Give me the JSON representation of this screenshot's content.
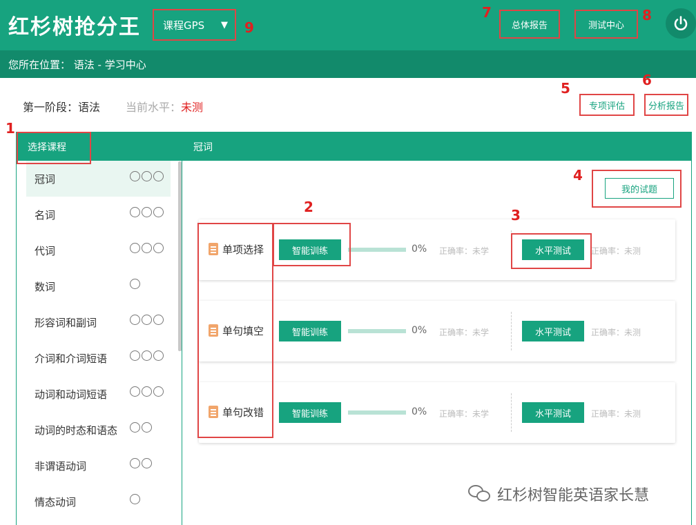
{
  "header": {
    "logo": "红杉树抢分王",
    "course_select": {
      "value": "课程GPS",
      "caret": "▼"
    },
    "overall_report": "总体报告",
    "test_center": "测试中心",
    "power_icon": "power-icon"
  },
  "breadcrumb": "您所在位置： 语法 - 学习中心",
  "stage": {
    "title": "第一阶段：语法",
    "level_label": "当前水平：",
    "level_value": "未测",
    "special_eval": "专项评估",
    "analysis_report": "分析报告"
  },
  "sidebar": {
    "title": "选择课程",
    "items": [
      {
        "label": "冠词",
        "circles": 3,
        "active": true
      },
      {
        "label": "名词",
        "circles": 3
      },
      {
        "label": "代词",
        "circles": 3
      },
      {
        "label": "数词",
        "circles": 1
      },
      {
        "label": "形容词和副词",
        "circles": 3
      },
      {
        "label": "介词和介词短语",
        "circles": 3
      },
      {
        "label": "动词和动词短语",
        "circles": 3
      },
      {
        "label": "动词的时态和语态",
        "circles": 2
      },
      {
        "label": "非谓语动词",
        "circles": 2
      },
      {
        "label": "情态动词",
        "circles": 1
      }
    ]
  },
  "main": {
    "title": "冠词",
    "my_test": "我的试题",
    "exercises": [
      {
        "title": "单项选择",
        "train": "智能训练",
        "progress": 0,
        "progress_text": "0%",
        "train_accuracy": "正确率：未学",
        "level_test": "水平测试",
        "level_accuracy": "正确率：未测"
      },
      {
        "title": "单句填空",
        "train": "智能训练",
        "progress": 0,
        "progress_text": "0%",
        "train_accuracy": "正确率：未学",
        "level_test": "水平测试",
        "level_accuracy": "正确率：未测"
      },
      {
        "title": "单句改错",
        "train": "智能训练",
        "progress": 0,
        "progress_text": "0%",
        "train_accuracy": "正确率：未学",
        "level_test": "水平测试",
        "level_accuracy": "正确率：未测"
      }
    ]
  },
  "annotations": [
    "1",
    "2",
    "3",
    "4",
    "5",
    "6",
    "7",
    "8",
    "9"
  ],
  "watermark": "红杉树智能英语家长慧",
  "colors": {
    "primary": "#17a37f",
    "dark": "#128a6b",
    "highlight": "#e04545"
  }
}
